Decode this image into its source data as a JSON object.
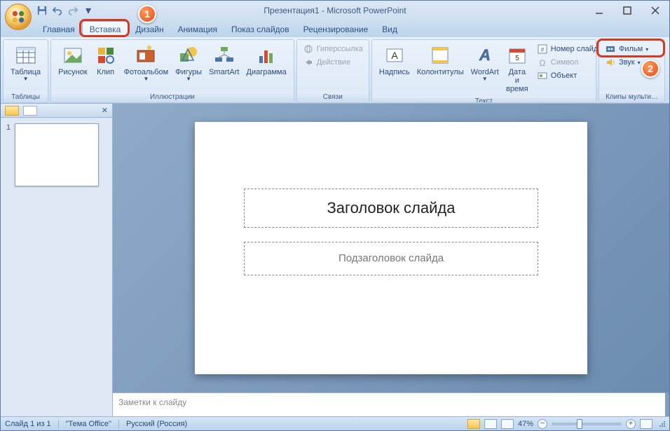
{
  "title": "Презентация1 - Microsoft PowerPoint",
  "tabs": [
    "Главная",
    "Вставка",
    "Дизайн",
    "Анимация",
    "Показ слайдов",
    "Рецензирование",
    "Вид"
  ],
  "active_tab": 1,
  "ribbon": {
    "tables": {
      "label": "Таблицы",
      "table": "Таблица"
    },
    "illustrations": {
      "label": "Иллюстрации",
      "picture": "Рисунок",
      "clip": "Клип",
      "photo": "Фотоальбом",
      "shapes": "Фигуры",
      "smartart": "SmartArt",
      "chart": "Диаграмма"
    },
    "links": {
      "label": "Связи",
      "hyperlink": "Гиперссылка",
      "action": "Действие"
    },
    "text": {
      "label": "Текст",
      "textbox": "Надпись",
      "headerfooter": "Колонтитулы",
      "wordart": "WordArt",
      "datetime": "Дата и время",
      "slidenum": "Номер слайда",
      "symbol": "Символ",
      "object": "Объект"
    },
    "media": {
      "label": "Клипы мульти…",
      "movie": "Фильм",
      "sound": "Звук"
    }
  },
  "callouts": {
    "tab": "1",
    "movie": "2"
  },
  "thumb_num": "1",
  "slide": {
    "title": "Заголовок слайда",
    "subtitle": "Подзаголовок слайда"
  },
  "notes_placeholder": "Заметки к слайду",
  "status": {
    "slide": "Слайд 1 из 1",
    "theme": "\"Тема Office\"",
    "lang": "Русский (Россия)",
    "zoom": "47%"
  }
}
